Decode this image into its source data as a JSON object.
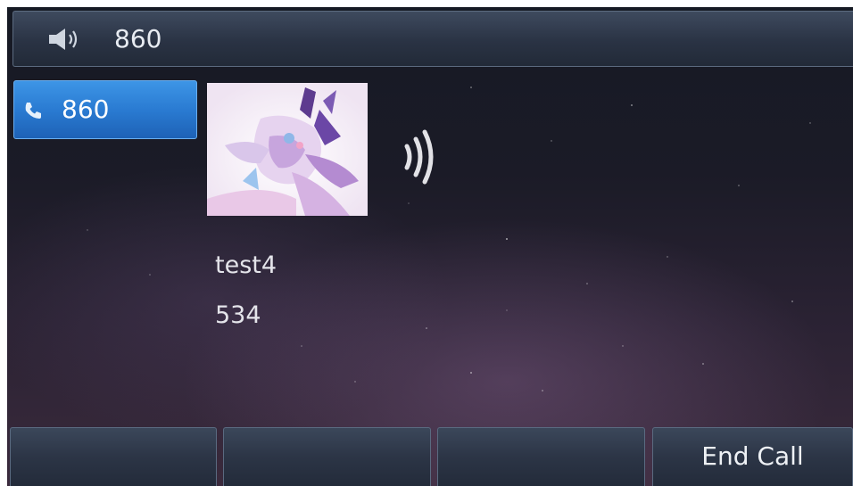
{
  "topbar": {
    "icon": "speaker-icon",
    "number": "860"
  },
  "line_key": {
    "icon": "phone-icon",
    "label": "860",
    "color": "#2a7bd2"
  },
  "call": {
    "avatar_icon": "contact-avatar",
    "status_icon": "ringing-icon",
    "name": "test4",
    "number": "534"
  },
  "softkeys": [
    {
      "label": ""
    },
    {
      "label": ""
    },
    {
      "label": ""
    },
    {
      "label": "End Call"
    }
  ]
}
